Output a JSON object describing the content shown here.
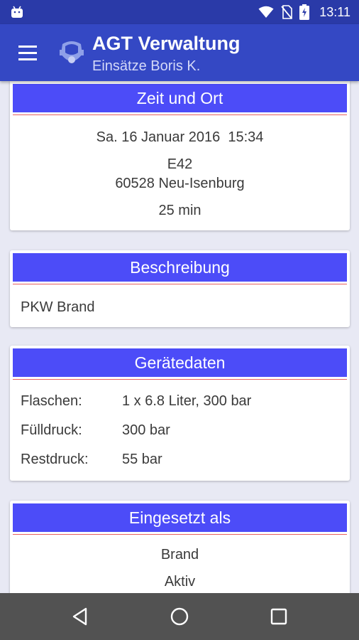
{
  "status_bar": {
    "time": "13:11",
    "icons": [
      "android-icon",
      "wifi-icon",
      "no-sim-icon",
      "battery-charging-icon"
    ]
  },
  "app_bar": {
    "title": "AGT Verwaltung",
    "subtitle": "Einsätze Boris K.",
    "icons": [
      "menu-icon",
      "respirator-mask-icon"
    ]
  },
  "cards": {
    "zeit_ort": {
      "title": "Zeit und Ort",
      "datetime": "Sa. 16 Januar 2016  15:34",
      "location_code": "E42",
      "address": "60528 Neu-Isenburg",
      "duration": "25 min"
    },
    "beschreibung": {
      "title": "Beschreibung",
      "text": "PKW Brand"
    },
    "geraetedaten": {
      "title": "Gerätedaten",
      "rows": [
        {
          "label": "Flaschen:",
          "value": "1 x 6.8 Liter, 300 bar"
        },
        {
          "label": "Fülldruck:",
          "value": "300 bar"
        },
        {
          "label": "Restdruck:",
          "value": "55 bar"
        }
      ]
    },
    "eingesetzt": {
      "title": "Eingesetzt als",
      "items": [
        "Brand",
        "Aktiv"
      ]
    }
  },
  "nav_bar": {
    "icons": [
      "back-icon",
      "home-icon",
      "recents-icon"
    ]
  },
  "colors": {
    "status_bar": "#2a3aa8",
    "app_bar": "#3448c4",
    "card_header": "#4c4cf8",
    "divider": "#e66060",
    "background": "#e8e9f4"
  }
}
